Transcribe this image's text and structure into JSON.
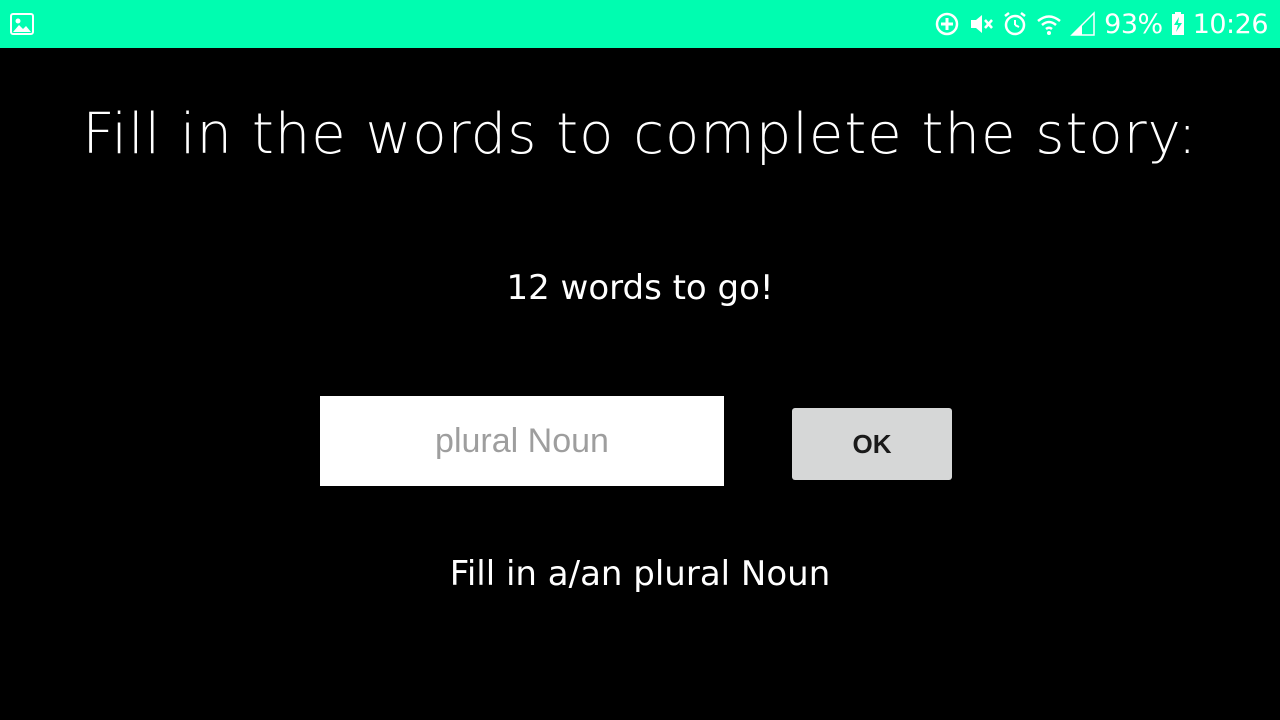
{
  "status_bar": {
    "background": "#00fdb0",
    "battery": "93%",
    "time": "10:26",
    "icons": [
      "image-icon",
      "data-saver-icon",
      "mute-icon",
      "alarm-icon",
      "wifi-icon",
      "signal-icon",
      "battery-charging-icon"
    ]
  },
  "main": {
    "title": "Fill in the words to complete the story:",
    "remaining": "12 words to go!",
    "input": {
      "value": "",
      "placeholder": "plural Noun"
    },
    "ok_label": "OK",
    "hint": "Fill in a/an plural Noun"
  }
}
